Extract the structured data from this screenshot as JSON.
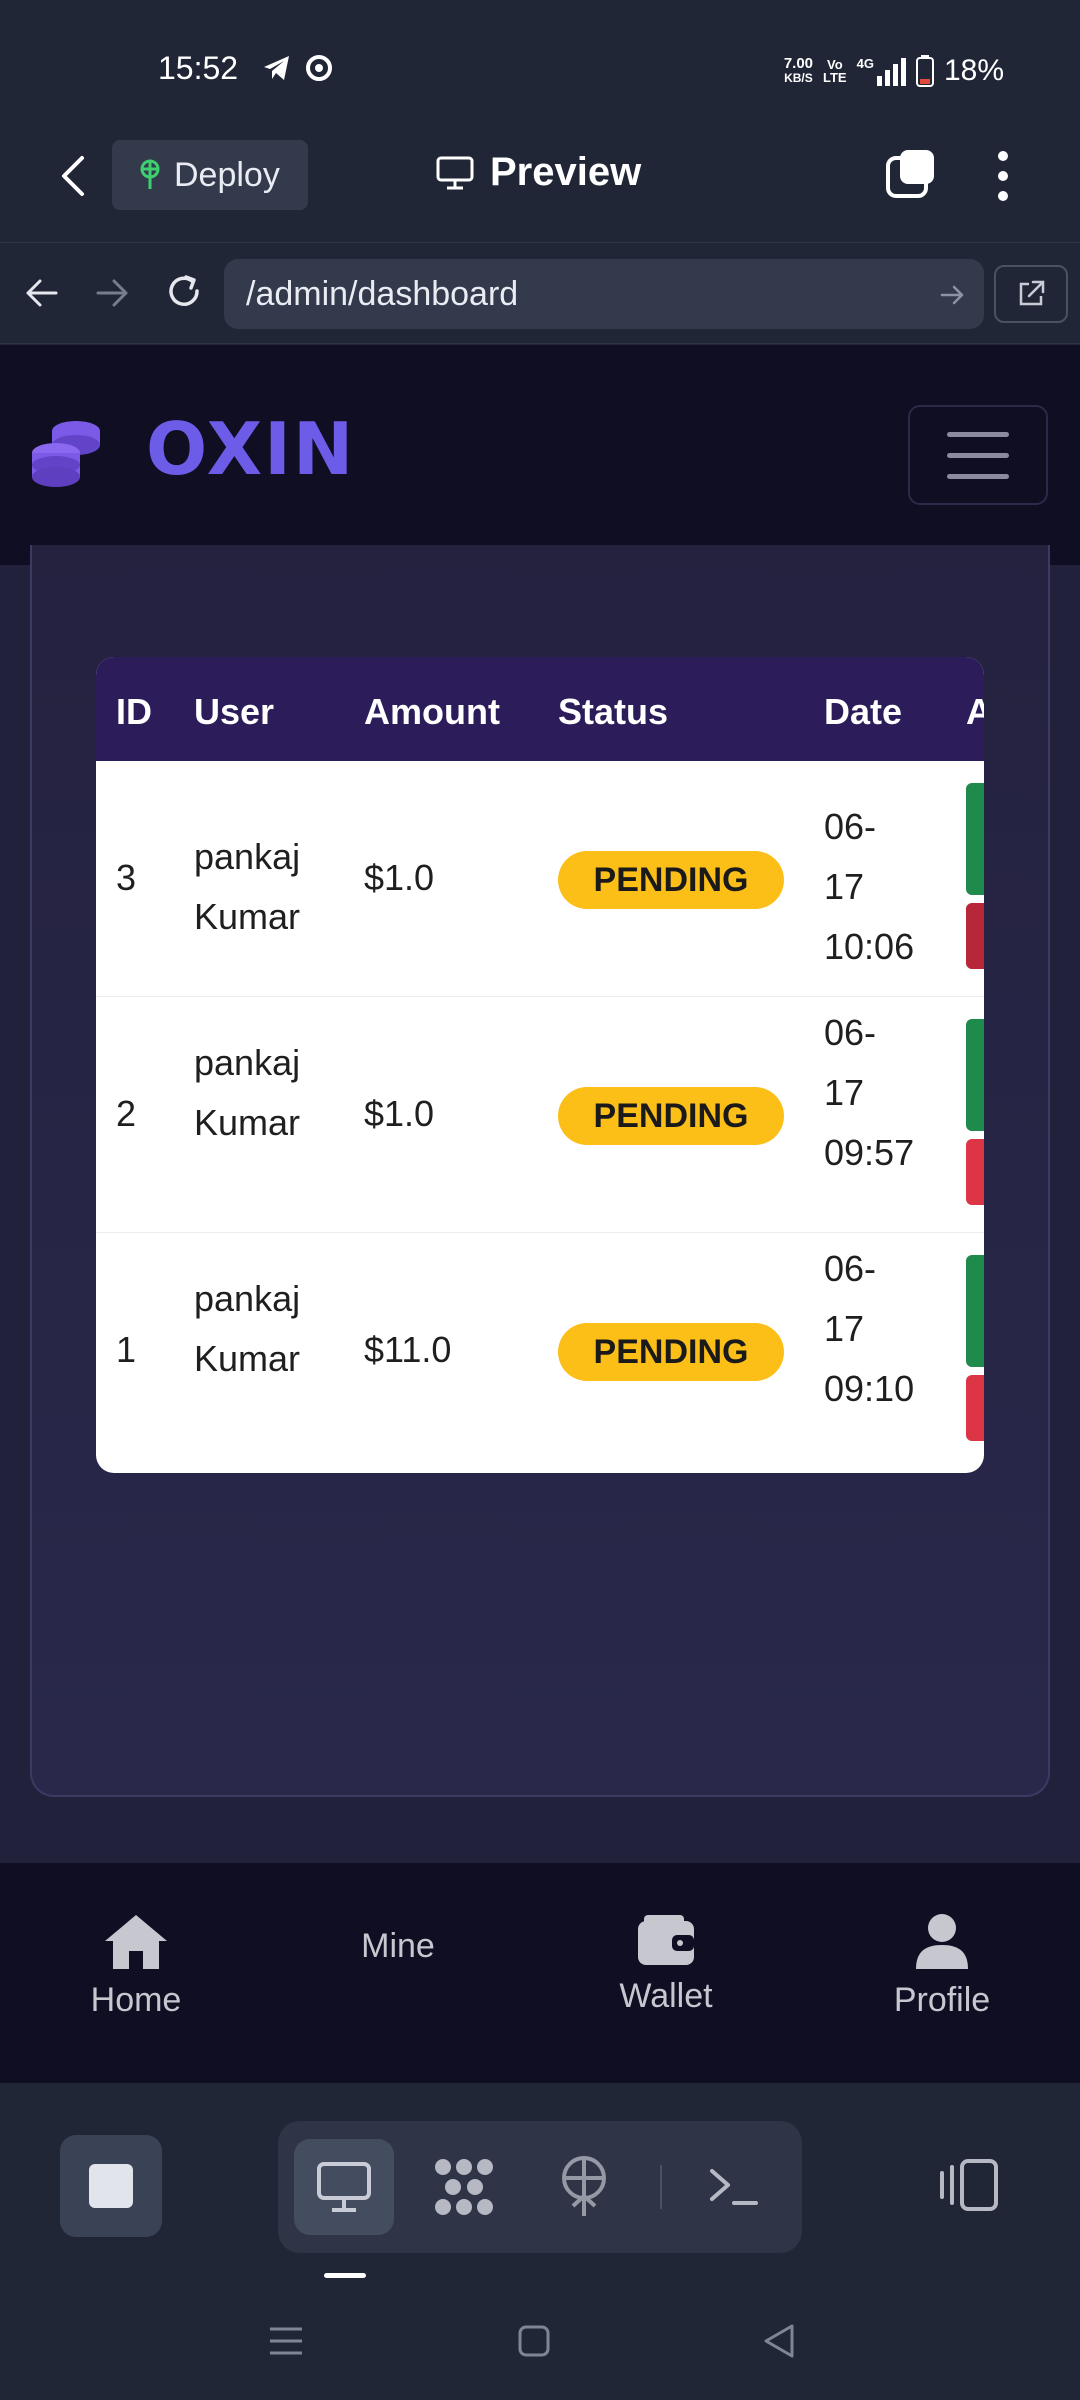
{
  "status_bar": {
    "time": "15:52",
    "net_speed_value": "7.00",
    "net_speed_unit": "KB/S",
    "volte_top": "Vo",
    "volte_bottom": "LTE",
    "signal_label": "4G",
    "battery": "18%"
  },
  "app_bar": {
    "deploy_label": "Deploy",
    "title": "Preview"
  },
  "url_bar": {
    "url": "/admin/dashboard"
  },
  "site": {
    "brand": "OXIN",
    "table": {
      "headers": [
        "ID",
        "User",
        "Amount",
        "Status",
        "Date",
        "A"
      ],
      "rows": [
        {
          "id": "3",
          "user_first": "pankaj",
          "user_last": "Kumar",
          "amount": "$1.0",
          "status": "PENDING",
          "date_1": "06-",
          "date_2": "17",
          "date_3": "10:06"
        },
        {
          "id": "2",
          "user_first": "pankaj",
          "user_last": "Kumar",
          "amount": "$1.0",
          "status": "PENDING",
          "date_1": "06-",
          "date_2": "17",
          "date_3": "09:57"
        },
        {
          "id": "1",
          "user_first": "pankaj",
          "user_last": "Kumar",
          "amount": "$11.0",
          "status": "PENDING",
          "date_1": "06-",
          "date_2": "17",
          "date_3": "09:10"
        }
      ]
    },
    "bottom_nav": [
      {
        "label": "Home",
        "icon": "home-icon"
      },
      {
        "label": "Mine",
        "icon": ""
      },
      {
        "label": "Wallet",
        "icon": "wallet-icon"
      },
      {
        "label": "Profile",
        "icon": "user-icon"
      }
    ]
  },
  "colors": {
    "brand": "#6d5ce8",
    "badge_pending": "#fcbf18",
    "approve": "#1e8a4c",
    "reject": "#c62b3a",
    "table_header": "#2c1c5a"
  }
}
